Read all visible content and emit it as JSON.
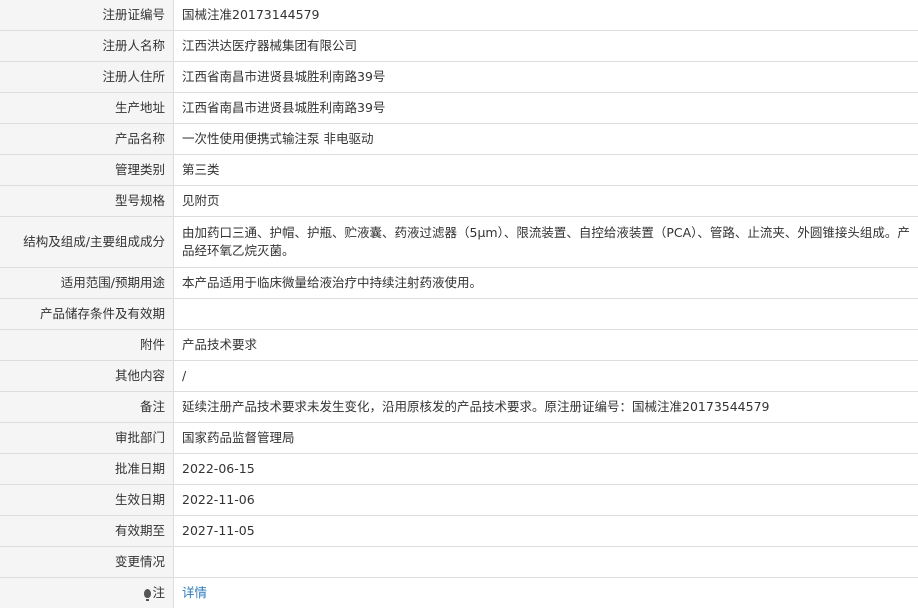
{
  "rows": [
    {
      "label": "注册证编号",
      "value": "国械注准20173144579"
    },
    {
      "label": "注册人名称",
      "value": "江西洪达医疗器械集团有限公司"
    },
    {
      "label": "注册人住所",
      "value": "江西省南昌市进贤县城胜利南路39号"
    },
    {
      "label": "生产地址",
      "value": "江西省南昌市进贤县城胜利南路39号"
    },
    {
      "label": "产品名称",
      "value": "一次性使用便携式输注泵 非电驱动"
    },
    {
      "label": "管理类别",
      "value": "第三类"
    },
    {
      "label": "型号规格",
      "value": "见附页"
    },
    {
      "label": "结构及组成/主要组成成分",
      "value": "由加药口三通、护帽、护瓶、贮液囊、药液过滤器（5μm）、限流装置、自控给液装置（PCA）、管路、止流夹、外圆锥接头组成。产品经环氧乙烷灭菌。"
    },
    {
      "label": "适用范围/预期用途",
      "value": "本产品适用于临床微量给液治疗中持续注射药液使用。"
    },
    {
      "label": "产品储存条件及有效期",
      "value": ""
    },
    {
      "label": "附件",
      "value": "产品技术要求"
    },
    {
      "label": "其他内容",
      "value": "/"
    },
    {
      "label": "备注",
      "value": "延续注册产品技术要求未发生变化，沿用原核发的产品技术要求。原注册证编号：国械注准20173544579"
    },
    {
      "label": "审批部门",
      "value": "国家药品监督管理局"
    },
    {
      "label": "批准日期",
      "value": "2022-06-15"
    },
    {
      "label": "生效日期",
      "value": "2022-11-06"
    },
    {
      "label": "有效期至",
      "value": "2027-11-05"
    },
    {
      "label": "变更情况",
      "value": ""
    },
    {
      "label": "注",
      "value": "详情",
      "label_icon": "lightbulb-icon"
    }
  ],
  "colors": {
    "label_bg": "#f5f5f5",
    "border": "#dddddd",
    "link": "#2b7bbd"
  }
}
